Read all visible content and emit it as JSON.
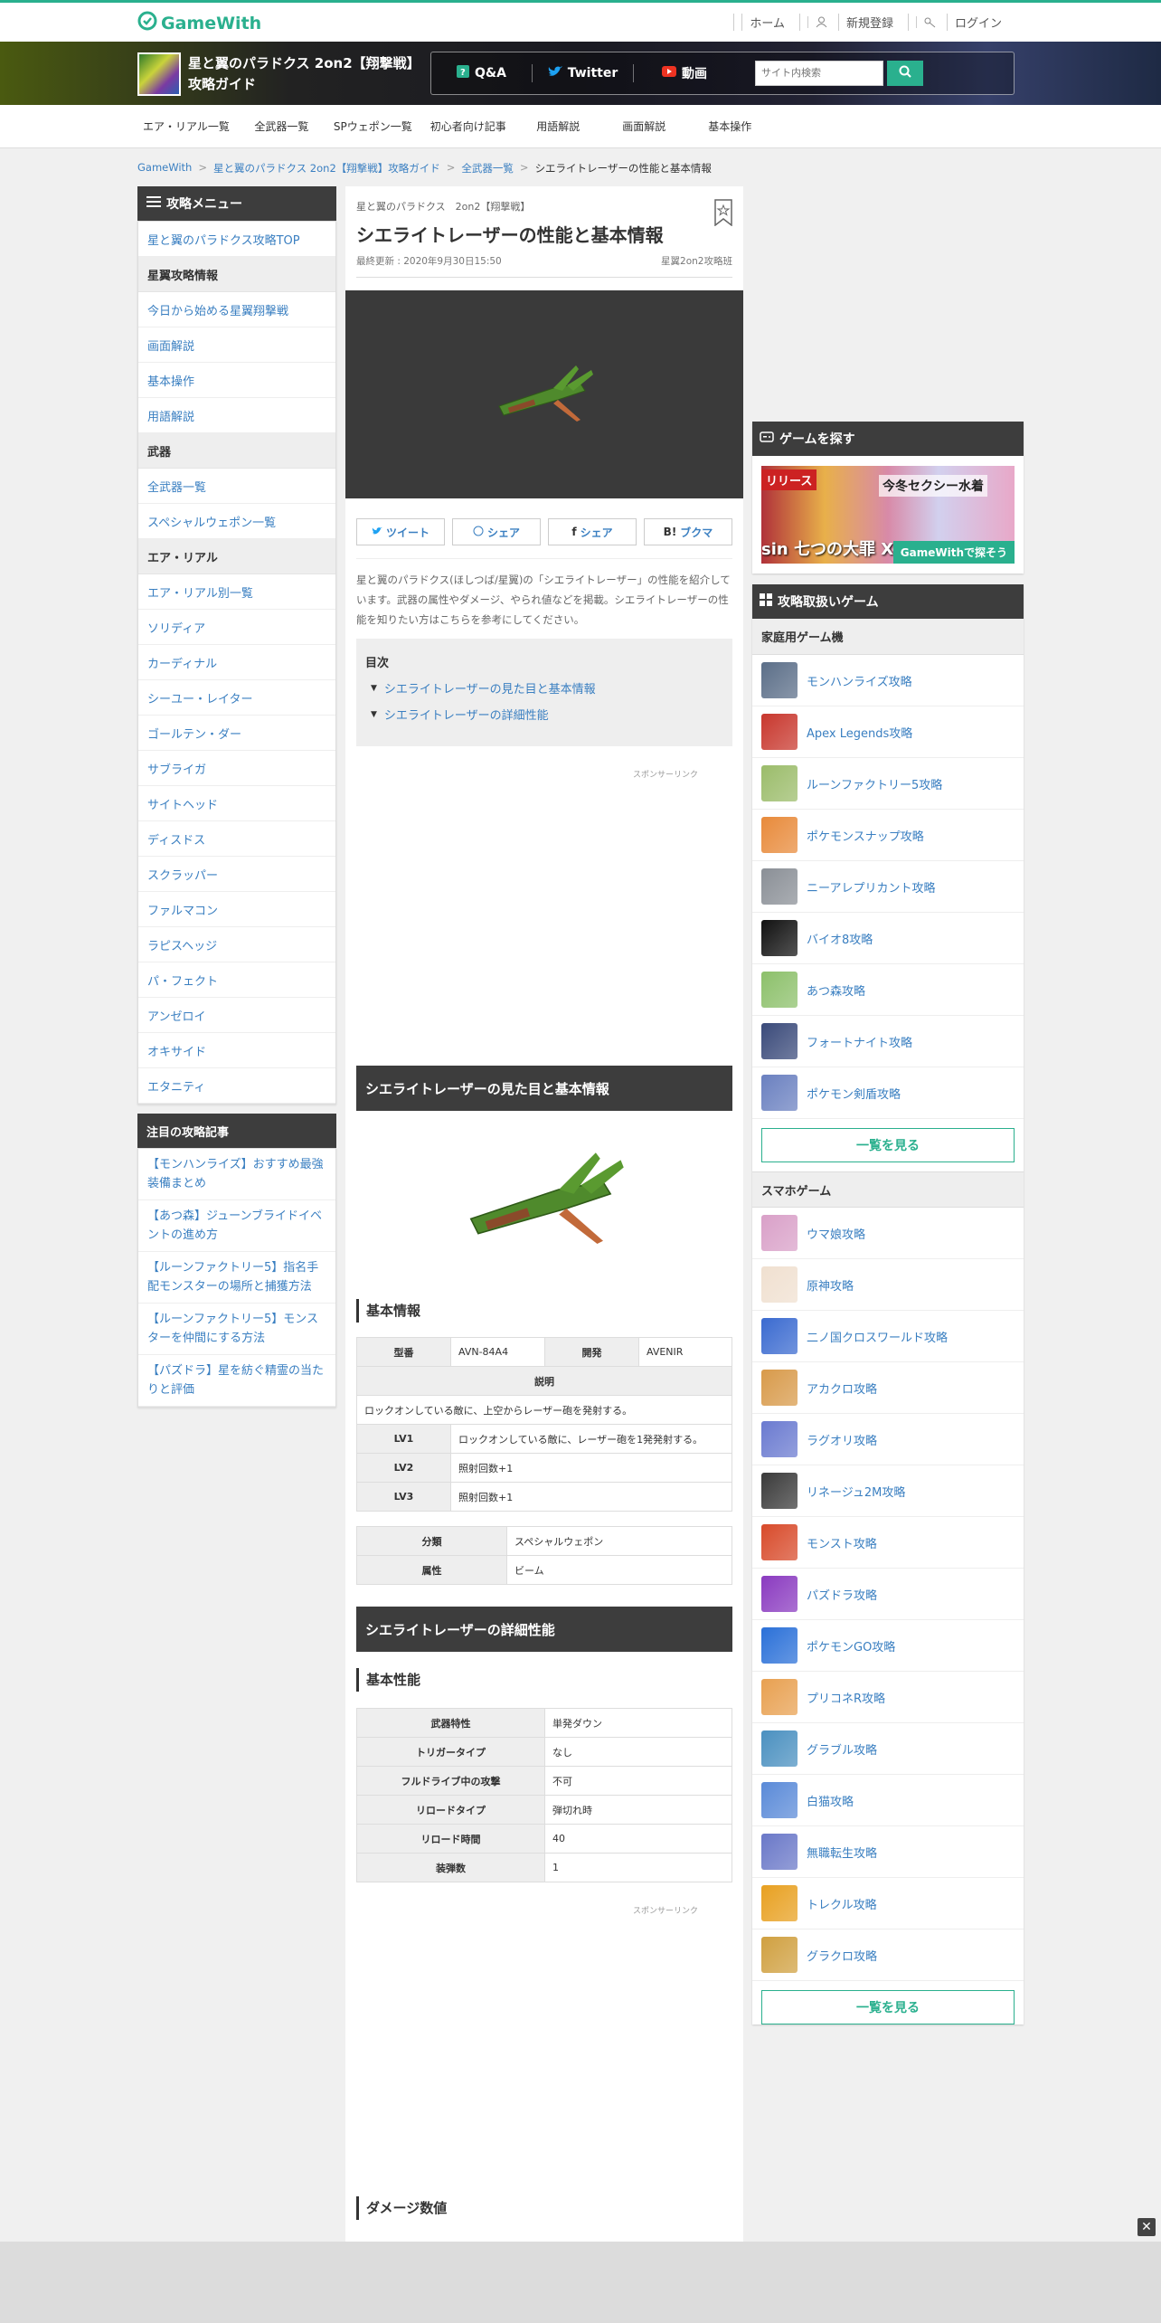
{
  "header": {
    "logo_text": "GameWith",
    "links": [
      "ホーム",
      "新規登録",
      "ログイン"
    ]
  },
  "banner": {
    "title": "星と翼のパラドクス 2on2【翔撃戦】攻略ガイド",
    "buttons": [
      "Q&A",
      "Twitter",
      "動画"
    ],
    "search_placeholder": "サイト内検索"
  },
  "nav": [
    "エア・リアル一覧",
    "全武器一覧",
    "SPウェポン一覧",
    "初心者向け記事",
    "用語解説",
    "画面解説",
    "基本操作"
  ],
  "breadcrumb": [
    "GameWith",
    "星と翼のパラドクス 2on2【翔撃戦】攻略ガイド",
    "全武器一覧",
    "シエライトレーザーの性能と基本情報"
  ],
  "left_menu": {
    "header": "攻略メニュー",
    "top_link": "星と翼のパラドクス攻略TOP",
    "sections": [
      {
        "title": "星翼攻略情報",
        "items": [
          "今日から始める星翼翔撃戦",
          "画面解説",
          "基本操作",
          "用語解説"
        ]
      },
      {
        "title": "武器",
        "items": [
          "全武器一覧",
          "スペシャルウェポン一覧"
        ]
      },
      {
        "title": "エア・リアル",
        "items": [
          "エア・リアル別一覧",
          "ソリディア",
          "カーディナル",
          "シーユー・レイター",
          "ゴールテン・ダー",
          "サブライガ",
          "サイトヘッド",
          "ディスドス",
          "スクラッパー",
          "ファルマコン",
          "ラピスヘッジ",
          "パ・フェクト",
          "アンゼロイ",
          "オキサイド",
          "エタニティ"
        ]
      }
    ]
  },
  "featured": {
    "header": "注目の攻略記事",
    "items": [
      "【モンハンライズ】おすすめ最強装備まとめ",
      "【あつ森】ジューンブライドイベントの進め方",
      "【ルーンファクトリー5】指名手配モンスターの場所と捕獲方法",
      "【ルーンファクトリー5】モンスターを仲間にする方法",
      "【パズドラ】星を紡ぐ精霊の当たりと評価"
    ]
  },
  "article": {
    "subtitle": "星と翼のパラドクス　2on2【翔撃戦】",
    "title": "シエライトレーザーの性能と基本情報",
    "updated": "最終更新 : 2020年9月30日15:50",
    "team": "星翼2on2攻略班",
    "share": [
      "ツイート",
      "シェア",
      "シェア",
      "ブクマ"
    ],
    "intro": "星と翼のパラドクス(ほしつば/星翼)の「シエライトレーザー」の性能を紹介しています。武器の属性やダメージ、やられ値などを掲載。シエライトレーザーの性能を知りたい方はこちらを参考にしてください。",
    "toc_title": "目次",
    "toc": [
      "シエライトレーザーの見た目と基本情報",
      "シエライトレーザーの詳細性能"
    ],
    "sponsor": "スポンサーリンク",
    "section1": "シエライトレーザーの見た目と基本情報",
    "basic_info": "基本情報",
    "t1": {
      "model_label": "型番",
      "model": "AVN-84A4",
      "dev_label": "開発",
      "dev": "AVENIR",
      "desc_label": "説明",
      "desc": "ロックオンしている敵に、上空からレーザー砲を発射する。",
      "lv": [
        {
          "label": "LV1",
          "text": "ロックオンしている敵に、レーザー砲を1発発射する。"
        },
        {
          "label": "LV2",
          "text": "照射回数+1"
        },
        {
          "label": "LV3",
          "text": "照射回数+1"
        }
      ]
    },
    "t2": [
      {
        "label": "分類",
        "value": "スペシャルウェポン"
      },
      {
        "label": "属性",
        "value": "ビーム"
      }
    ],
    "section2": "シエライトレーザーの詳細性能",
    "basic_perf": "基本性能",
    "t3": [
      {
        "label": "武器特性",
        "value": "単発ダウン"
      },
      {
        "label": "トリガータイプ",
        "value": "なし"
      },
      {
        "label": "フルドライブ中の攻撃",
        "value": "不可"
      },
      {
        "label": "リロードタイプ",
        "value": "弾切れ時"
      },
      {
        "label": "リロード時間",
        "value": "40"
      },
      {
        "label": "装弾数",
        "value": "1"
      }
    ],
    "damage": "ダメージ数値"
  },
  "right": {
    "find_header": "ゲームを探す",
    "promo": {
      "top": "リリース",
      "mid": "今冬セクシー水着",
      "bottom": "sin 七つの大罪 X-TASY",
      "badge": "GameWithで探そう"
    },
    "handled_header": "攻略取扱いゲーム",
    "console_title": "家庭用ゲーム機",
    "console": [
      "モンハンライズ攻略",
      "Apex Legends攻略",
      "ルーンファクトリー5攻略",
      "ポケモンスナップ攻略",
      "ニーアレプリカント攻略",
      "バイオ8攻略",
      "あつ森攻略",
      "フォートナイト攻略",
      "ポケモン剣盾攻略"
    ],
    "more": "一覧を見る",
    "mobile_title": "スマホゲーム",
    "mobile": [
      "ウマ娘攻略",
      "原神攻略",
      "二ノ国クロスワールド攻略",
      "アカクロ攻略",
      "ラグオリ攻略",
      "リネージュ2M攻略",
      "モンスト攻略",
      "パズドラ攻略",
      "ポケモンGO攻略",
      "プリコネR攻略",
      "グラブル攻略",
      "白猫攻略",
      "無職転生攻略",
      "トレクル攻略",
      "グラクロ攻略"
    ],
    "icon_colors": [
      "#5b6e88",
      "#c8372d",
      "#9bbc6a",
      "#e88a3a",
      "#8a8f96",
      "#111111",
      "#8cc06a",
      "#3a4a7a",
      "#6a80c0",
      "#d9a0c8",
      "#f0e0d0",
      "#3a6ad0",
      "#d89a4a",
      "#6a7ad0",
      "#3a3a3a",
      "#d84a2a",
      "#8a3ac0",
      "#2a70d8",
      "#e8a050",
      "#4a90c0",
      "#5a8ad8",
      "#6a78c8",
      "#e8a020",
      "#d0a040"
    ]
  }
}
